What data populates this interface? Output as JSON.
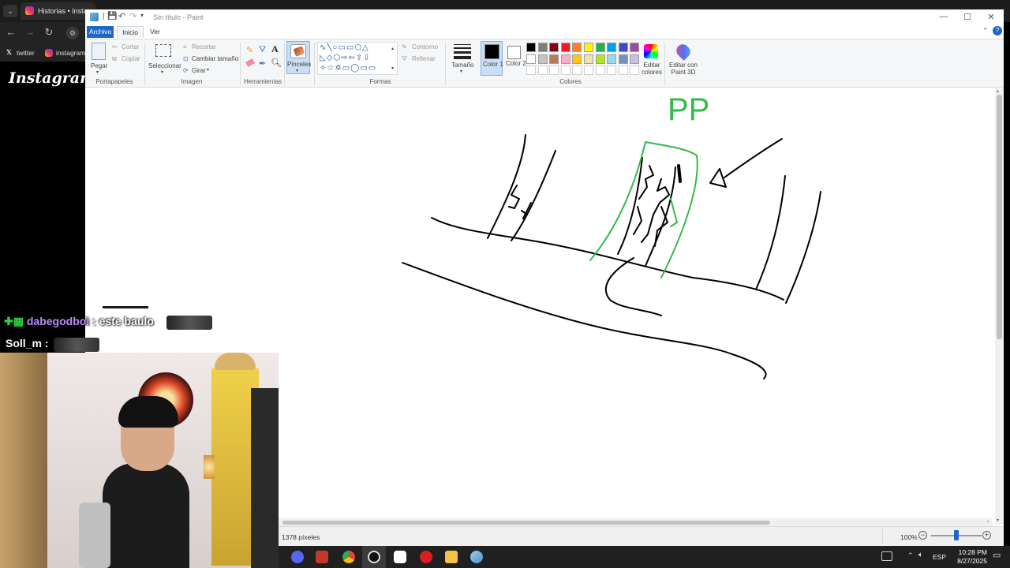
{
  "browser": {
    "tab_title": "Historias • Instagram",
    "bookmarks": [
      {
        "label": "twitter",
        "icon": "x-logo-icon"
      },
      {
        "label": "instagram",
        "icon": "instagram-logo-icon"
      }
    ],
    "page_logo": "Instagram"
  },
  "paint": {
    "title": "Sin título - Paint",
    "menu": {
      "file": "Archivo",
      "home": "Inicio",
      "view": "Ver"
    },
    "clipboard": {
      "paste": "Pegar",
      "cut": "Cortar",
      "copy": "Copiar",
      "group": "Portapapeles"
    },
    "image": {
      "select": "Seleccionar",
      "crop": "Recortar",
      "resize": "Cambiar tamaño",
      "rotate": "Girar",
      "group": "Imagen"
    },
    "tools": {
      "group": "Herramientas"
    },
    "brushes": {
      "label": "Pinceles"
    },
    "shapes": {
      "outline": "Contorno",
      "fill": "Rellenar",
      "group": "Formas"
    },
    "size": {
      "label": "Tamaño"
    },
    "color1": {
      "label": "Color 1",
      "value": "#000000"
    },
    "color2": {
      "label": "Color 2",
      "value": "#ffffff"
    },
    "colors": {
      "group": "Colores",
      "edit": "Editar colores",
      "row1": [
        "#000000",
        "#7f7f7f",
        "#880015",
        "#ed1c24",
        "#ff7f27",
        "#fff200",
        "#22b14c",
        "#00a2e8",
        "#3f48cc",
        "#a349a4"
      ],
      "row2": [
        "#ffffff",
        "#c3c3c3",
        "#b97a57",
        "#ffaec9",
        "#ffc90e",
        "#efe4b0",
        "#b5e61d",
        "#99d9ea",
        "#7092be",
        "#c8bfe7"
      ]
    },
    "paint3d": {
      "label": "Editar con Paint 3D"
    },
    "canvas_text": "PP",
    "status": {
      "size": "1378 píxeles",
      "zoom": "100%",
      "zoom_fraction": 0.5
    }
  },
  "chat": [
    {
      "user": "dabegodboi",
      "message": ": este baulo",
      "user_color": "#b98cff"
    },
    {
      "user": "Soll_m",
      "message": ":",
      "user_color": "#ffffff"
    }
  ],
  "taskbar": {
    "language": "ESP",
    "time": "10:28 PM",
    "date": "8/27/2025"
  }
}
